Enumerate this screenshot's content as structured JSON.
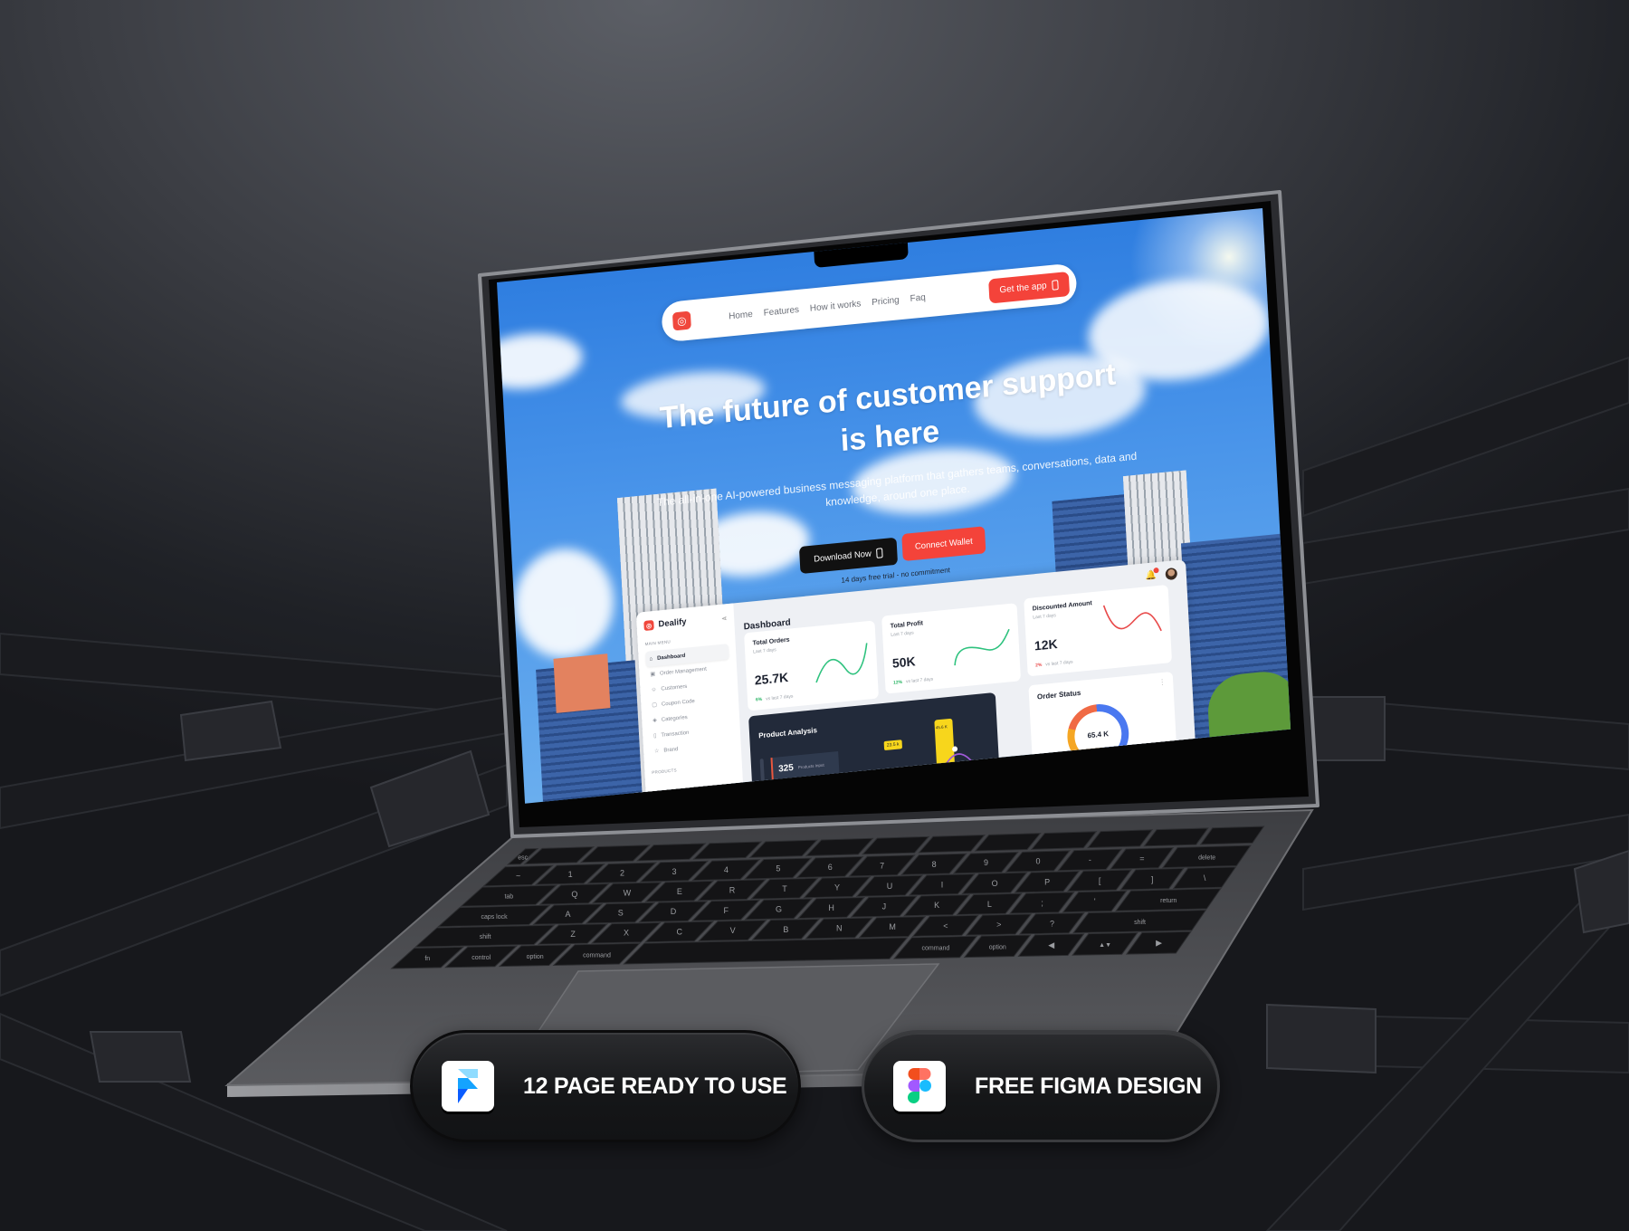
{
  "landing": {
    "nav": {
      "links": [
        "Home",
        "Features",
        "How it works",
        "Pricing",
        "Faq"
      ],
      "cta": "Get the app",
      "cta_icon": "phone-icon"
    },
    "hero": {
      "title_line1": "The future of customer support",
      "title_line2": "is here",
      "subtitle": "The all-in-one AI-powered business messaging platform that gathers teams, conversations, data and knowledge, around one place.",
      "download_label": "Download Now",
      "connect_label": "Connect Wallet",
      "trial_note": "14 days free trial - no commitment"
    },
    "accent": "#f4433a"
  },
  "dashboard": {
    "brand": "Dealify",
    "section_main": "MAIN MENU",
    "menu": [
      "Dashboard",
      "Order Management",
      "Customers",
      "Coupon Code",
      "Categories",
      "Transaction",
      "Brand"
    ],
    "section_products": "PRODUCTS",
    "title": "Dashboard",
    "cards": [
      {
        "title": "Total Orders",
        "period": "Last 7 days",
        "value": "25.7K",
        "change": "6%",
        "compare": "vs last 7 days",
        "trend": "up"
      },
      {
        "title": "Total Profit",
        "period": "Last 7 days",
        "value": "50K",
        "change": "12%",
        "compare": "vs last 7 days",
        "trend": "up"
      },
      {
        "title": "Discounted Amount",
        "period": "Last 7 days",
        "value": "12K",
        "change": "2%",
        "compare": "vs last 7 days",
        "trend": "up-red"
      }
    ],
    "product_analysis": {
      "title": "Product Analysis",
      "count": "325",
      "count_label": "Products Input",
      "tooltip": "23.5 k",
      "bar_label": "45.6 K"
    },
    "order_status": {
      "title": "Order Status",
      "total": "65.4 K"
    }
  },
  "keyboard": {
    "rows": [
      [
        "esc",
        "",
        "",
        "",
        "",
        "",
        "",
        "",
        "",
        "",
        "",
        "",
        "",
        ""
      ],
      [
        "~",
        "1",
        "2",
        "3",
        "4",
        "5",
        "6",
        "7",
        "8",
        "9",
        "0",
        "-",
        "=",
        "delete"
      ],
      [
        "tab",
        "Q",
        "W",
        "E",
        "R",
        "T",
        "Y",
        "U",
        "I",
        "O",
        "P",
        "[",
        "]",
        "\\"
      ],
      [
        "caps lock",
        "A",
        "S",
        "D",
        "F",
        "G",
        "H",
        "J",
        "K",
        "L",
        ";",
        "'",
        "return"
      ],
      [
        "shift",
        "Z",
        "X",
        "C",
        "V",
        "B",
        "N",
        "M",
        "<",
        ">",
        "?",
        "shift"
      ],
      [
        "fn",
        "control",
        "option",
        "command",
        "",
        "command",
        "option",
        "◀",
        "▲▼",
        "▶"
      ]
    ]
  },
  "badges": [
    {
      "label": "12 PAGE READY TO USE",
      "icon": "framer-icon"
    },
    {
      "label": "FREE FIGMA DESIGN",
      "icon": "figma-icon"
    }
  ]
}
